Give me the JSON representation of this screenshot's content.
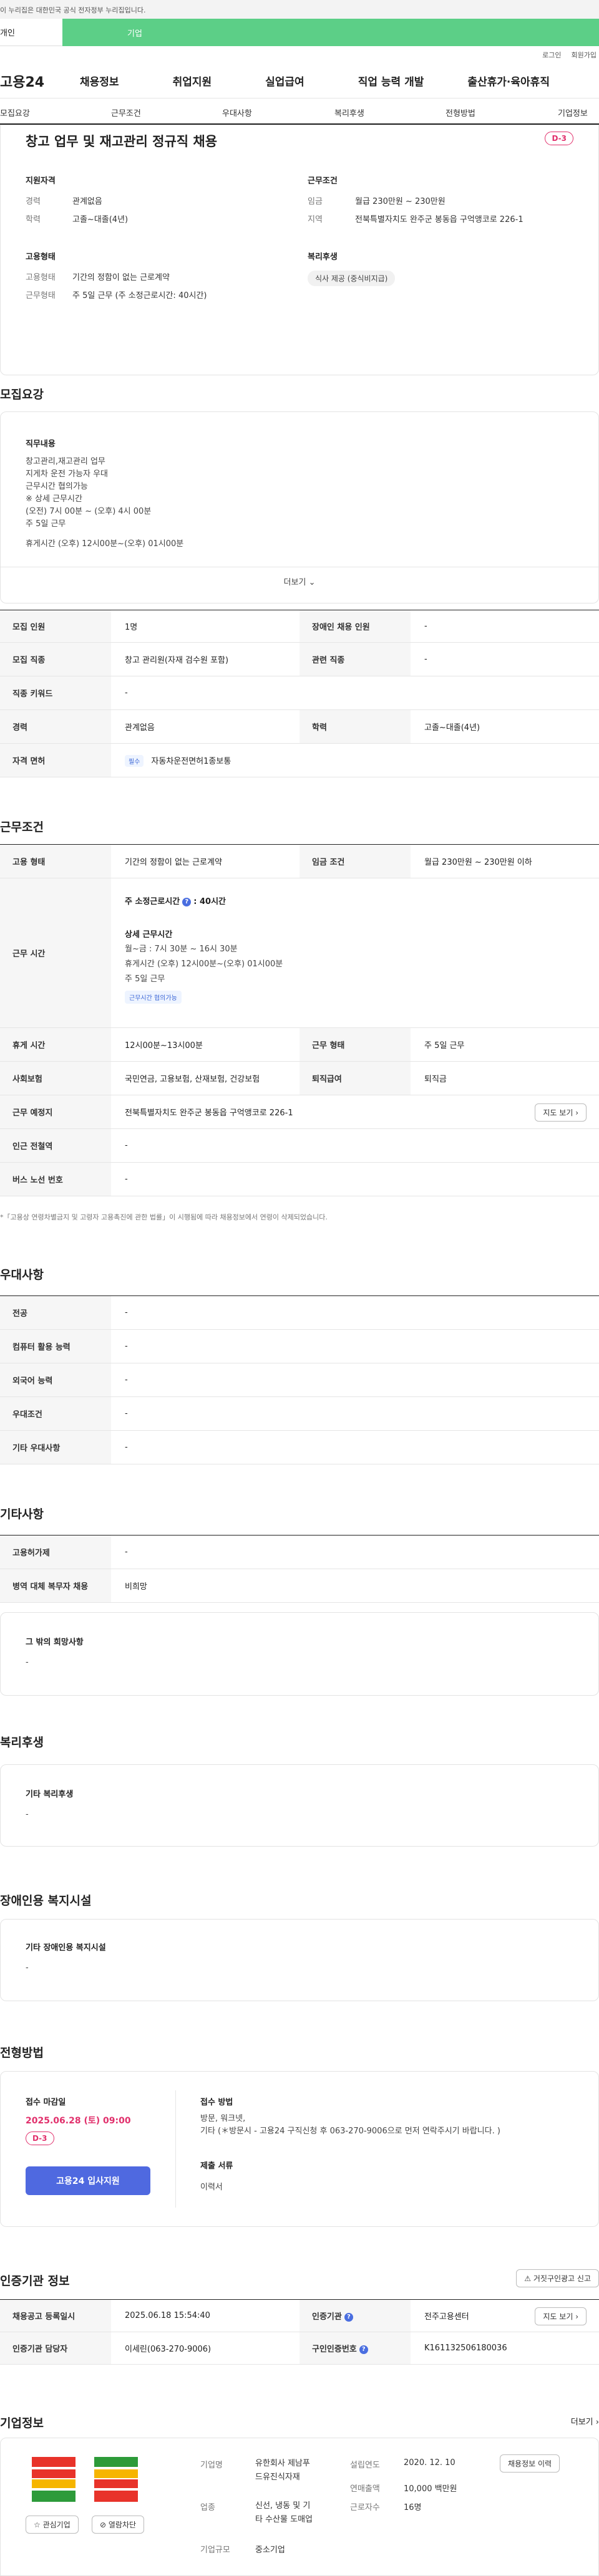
{
  "gov_bar": "이 누리집은 대한민국 공식 전자정부 누리집입니다.",
  "user_tabs": {
    "personal": "개인",
    "company": "기업"
  },
  "util": {
    "login": "로그인",
    "signup": "회원가입"
  },
  "gnb": {
    "logo": "고용24",
    "items": [
      "채용정보",
      "취업지원",
      "실업급여",
      "직업 능력 개발",
      "출산휴가·육아휴직"
    ]
  },
  "section_tabs": [
    "모집요강",
    "근무조건",
    "우대사항",
    "복리후생",
    "전형방법",
    "기업정보"
  ],
  "summary": {
    "title": "창고 업무 및 재고관리 정규직 채용",
    "dday": "D-3",
    "qual": {
      "title": "지원자격",
      "rows": [
        {
          "label": "경력",
          "value": "관계없음"
        },
        {
          "label": "학력",
          "value": "고졸~대졸(4년)"
        }
      ]
    },
    "work": {
      "title": "근무조건",
      "rows": [
        {
          "label": "임금",
          "value": "월급 230만원 ~ 230만원"
        },
        {
          "label": "지역",
          "value": "전북특별자치도 완주군 봉동읍 구억앵코로 226-1"
        }
      ]
    },
    "employ": {
      "title": "고용형태",
      "rows": [
        {
          "label": "고용형태",
          "value": "기간의 정함이 없는 근로계약"
        },
        {
          "label": "근무형태",
          "value": "주 5일 근무 (주 소정근로시간: 40시간)"
        }
      ]
    },
    "welfare": {
      "title": "복리후생",
      "chip": "식사 제공 (중식비지급)"
    }
  },
  "recruit": {
    "heading": "모집요강",
    "duty_title": "직무내용",
    "duty_lines": [
      "창고관리,재고관리 업무",
      "지게차 운전 가능자 우대",
      "근무시간 협의가능",
      "※ 상세 근무시간",
      "(오전) 7시 00분 ~ (오후) 4시 00분",
      "주 5일 근무",
      "",
      "휴게시간 (오후) 12시00분~(오후) 01시00분"
    ],
    "more": "더보기",
    "table": {
      "count_label": "모집 인원",
      "count": "1명",
      "disabled_label": "장애인 채용 인원",
      "disabled": "-",
      "job_label": "모집 직종",
      "job": "창고 관리원(자재 검수원 포함)",
      "related_label": "관련 직종",
      "related": "-",
      "keyword_label": "직종 키워드",
      "keyword": "-",
      "career_label": "경력",
      "career": "관계없음",
      "edu_label": "학력",
      "edu": "고졸~대졸(4년)",
      "license_label": "자격 면허",
      "license_tag": "필수",
      "license": "자동차운전면허1종보통"
    }
  },
  "work": {
    "heading": "근무조건",
    "employ_label": "고용 형태",
    "employ": "기간의 정함이 없는 근로계약",
    "wage_label": "임금 조건",
    "wage": "월급 230만원 ~ 230만원 이하",
    "hours_label": "근무 시간",
    "hours_main_prefix": "주 소정근로시간",
    "hours_main_value": ": 40시간",
    "hours_detail_title": "상세 근무시간",
    "hours_detail_lines": [
      "월~금 : 7시 30분 ~ 16시 30분",
      "휴게시간 (오후) 12시00분~(오후) 01시00분",
      "주 5일 근무"
    ],
    "hours_tag": "근무시간 협의가능",
    "break_label": "휴게 시간",
    "break": "12시00분~13시00분",
    "form_label": "근무 형태",
    "form": "주 5일 근무",
    "insurance_label": "사회보험",
    "insurance": "국민연금, 고용보험, 산재보험, 건강보험",
    "severance_label": "퇴직급여",
    "severance": "퇴직금",
    "place_label": "근무 예정지",
    "place": "전북특별자치도 완주군 봉동읍 구억앵코로 226-1",
    "map_btn": "지도 보기",
    "subway_label": "인근 전철역",
    "subway": "-",
    "bus_label": "버스 노선 번호",
    "bus": "-",
    "note": "*「고용상 연령차별금지 및 고령자 고용촉진에 관한 법률」이 시행됨에 따라 채용정보에서 연령이 삭제되었습니다."
  },
  "prefer": {
    "heading": "우대사항",
    "rows": [
      {
        "label": "전공",
        "value": "-"
      },
      {
        "label": "컴퓨터 활용 능력",
        "value": "-"
      },
      {
        "label": "외국어 능력",
        "value": "-"
      },
      {
        "label": "우대조건",
        "value": "-"
      },
      {
        "label": "기타 우대사항",
        "value": "-"
      }
    ]
  },
  "etc": {
    "heading": "기타사항",
    "rows": [
      {
        "label": "고용허가제",
        "value": "-"
      },
      {
        "label": "병역 대체 복무자 채용",
        "value": "비희망"
      }
    ],
    "hope_title": "그 밖의 희망사항",
    "hope": "-"
  },
  "benefit": {
    "heading": "복리후생",
    "title": "기타 복리후생",
    "value": "-"
  },
  "disabled_fac": {
    "heading": "장애인용 복지시설",
    "title": "기타 장애인용 복지시설",
    "value": "-"
  },
  "selection": {
    "heading": "전형방법",
    "deadline_title": "접수 마감일",
    "deadline": "2025.06.28 (토) 09:00",
    "dday": "D-3",
    "apply_btn": "고용24 입사지원",
    "method_title": "접수 방법",
    "method_lines": [
      "방문, 워크넷,",
      "기타 (＊방문시 -  고용24 구직신청 후 063-270-9006으로 먼저 연락주시기 바랍니다. )"
    ],
    "docs_title": "제출 서류",
    "docs": "이력서"
  },
  "cert": {
    "heading": "인증기관 정보",
    "report_btn": "거짓구인광고 신고",
    "reg_label": "채용공고 등록일시",
    "reg": "2025.06.18 15:54:40",
    "org_label": "인증기관",
    "org": "전주고용센터",
    "map_btn": "지도 보기",
    "manager_label": "인증기관 담당자",
    "manager": "이세린(063-270-9006)",
    "id_label": "구인인증번호",
    "id": "K161132506180036"
  },
  "company": {
    "heading": "기업정보",
    "more": "더보기",
    "fav_btn": "관심기업",
    "ad_btn": "열람차단",
    "name_label": "기업명",
    "name_lines": [
      "유한회사 제남푸",
      "드유진식자재"
    ],
    "founded_label": "설립연도",
    "founded": "2020. 12. 10",
    "jobs_btn": "채용정보 이력",
    "sales_label": "연매출액",
    "sales": "10,000 백만원",
    "industry_label": "업종",
    "industry_lines": [
      "신선, 냉동 및 기",
      "타 수산물 도매업"
    ],
    "workers_label": "근로자수",
    "workers": "16명",
    "size_label": "기업규모",
    "size": "중소기업"
  },
  "colors": {
    "accent": "#4f69e0",
    "brand_green": "#5ccf87",
    "dday": "#e1306c",
    "deadline": "#e1306c"
  }
}
